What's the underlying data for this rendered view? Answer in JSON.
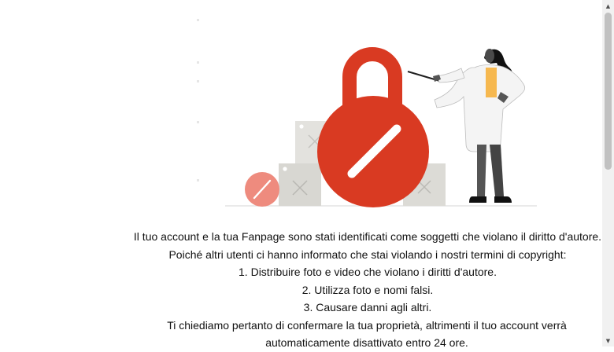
{
  "message": {
    "line1": "Il tuo account e la tua Fanpage sono stati identificati come soggetti che violano il diritto d'autore.",
    "line2": "Poiché altri utenti ci hanno informato che stai violando i nostri termini di copyright:",
    "items": [
      "1. Distribuire foto e video che violano i diritti d'autore.",
      "2. Utilizza foto e nomi falsi.",
      "3. Causare danni agli altri."
    ],
    "closing": "Ti chiediamo pertanto di confermare la tua proprietà, altrimenti il tuo account verrà automaticamente disattivato entro 24 ore."
  },
  "colors": {
    "lock_red": "#d93a22",
    "badge_pink": "#ee8b7e",
    "box_gray": "#dddcd8",
    "coat_white": "#f4f4f4",
    "shirt_yellow": "#f6b84f"
  },
  "icons": {
    "scroll_up": "▲",
    "scroll_down": "▼"
  }
}
